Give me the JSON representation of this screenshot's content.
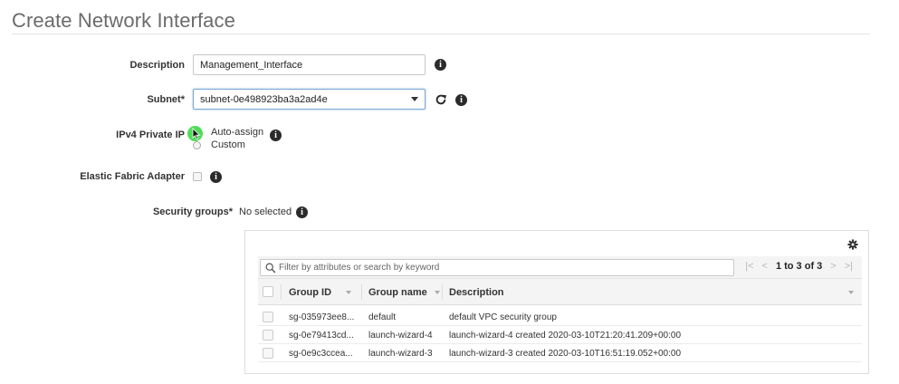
{
  "page": {
    "title": "Create Network Interface"
  },
  "form": {
    "description": {
      "label": "Description",
      "value": "Management_Interface"
    },
    "subnet": {
      "label": "Subnet*",
      "value": "subnet-0e498923ba3a2ad4e"
    },
    "ipv4": {
      "label": "IPv4 Private IP",
      "options": [
        "Auto-assign",
        "Custom"
      ],
      "selected": "Auto-assign"
    },
    "efa": {
      "label": "Elastic Fabric Adapter"
    },
    "security_groups": {
      "label": "Security groups*",
      "value": "No selected"
    }
  },
  "table": {
    "filter_placeholder": "Filter by attributes or search by keyword",
    "pager": {
      "range": "1 to 3 of 3"
    },
    "columns": [
      "Group ID",
      "Group name",
      "Description"
    ],
    "rows": [
      {
        "group_id": "sg-035973ee8...",
        "group_name": "default",
        "description": "default VPC security group"
      },
      {
        "group_id": "sg-0e79413cd...",
        "group_name": "launch-wizard-4",
        "description": "launch-wizard-4 created 2020-03-10T21:20:41.209+00:00"
      },
      {
        "group_id": "sg-0e9c3ccea...",
        "group_name": "launch-wizard-3",
        "description": "launch-wizard-3 created 2020-03-10T16:51:19.052+00:00"
      }
    ]
  },
  "colors": {
    "accent_focus": "#7aa7d6",
    "cursor_highlight": "#4fdc58",
    "title": "#6b6b6b"
  },
  "icons": [
    "info-icon",
    "refresh-icon",
    "gear-icon",
    "search-icon",
    "first-page-icon",
    "prev-page-icon",
    "next-page-icon",
    "last-page-icon"
  ]
}
